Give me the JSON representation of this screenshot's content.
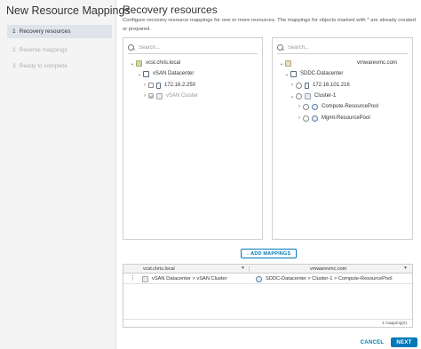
{
  "wizard": {
    "title": "New Resource Mappings",
    "steps": [
      {
        "num": "1",
        "label": "Recovery resources",
        "active": true
      },
      {
        "num": "2",
        "label": "Reverse mappings",
        "active": false
      },
      {
        "num": "3",
        "label": "Ready to complete",
        "active": false
      }
    ]
  },
  "main": {
    "title": "Recovery resources",
    "description": "Configure recovery resource mappings for one or more resources. The mappings for objects marked with * are already created or prepared."
  },
  "left_tree": {
    "search_placeholder": "Search...",
    "items": [
      {
        "label": "vcst.chris.local",
        "icon": "vcenter-icon"
      },
      {
        "label": "vSAN Datacenter",
        "icon": "datacenter-icon"
      },
      {
        "label": "172.16.2.250",
        "icon": "host-icon"
      },
      {
        "label": "vSAN Cluster",
        "icon": "cluster-icon"
      }
    ]
  },
  "right_tree": {
    "search_placeholder": "Search...",
    "items": [
      {
        "label": "vmwarevmc.com",
        "icon": "cloud-vcenter-icon"
      },
      {
        "label": "SDDC-Datacenter",
        "icon": "datacenter-icon"
      },
      {
        "label": "172.16.101.216",
        "icon": "host-icon"
      },
      {
        "label": "Cluster-1",
        "icon": "cluster-icon"
      },
      {
        "label": "Compute-ResourcePool",
        "icon": "resource-pool-icon"
      },
      {
        "label": "Mgmt-ResourcePool",
        "icon": "resource-pool-icon"
      }
    ]
  },
  "add_mappings_label": "↓ ADD MAPPINGS",
  "grid": {
    "columns": [
      "vcst.chris.local",
      "vmwarevmc.com"
    ],
    "rows": [
      {
        "source": "vSAN Datacenter > vSAN Cluster",
        "target": "SDDC-Datacenter > Cluster-1 > Compute-ResourcePool"
      }
    ],
    "footer": "1 mapping(s)"
  },
  "buttons": {
    "cancel": "CANCEL",
    "next": "NEXT"
  },
  "colors": {
    "accent": "#0079b8",
    "sidebar_bg": "#f4f4f4",
    "active_step_bg": "#dde3e9"
  }
}
